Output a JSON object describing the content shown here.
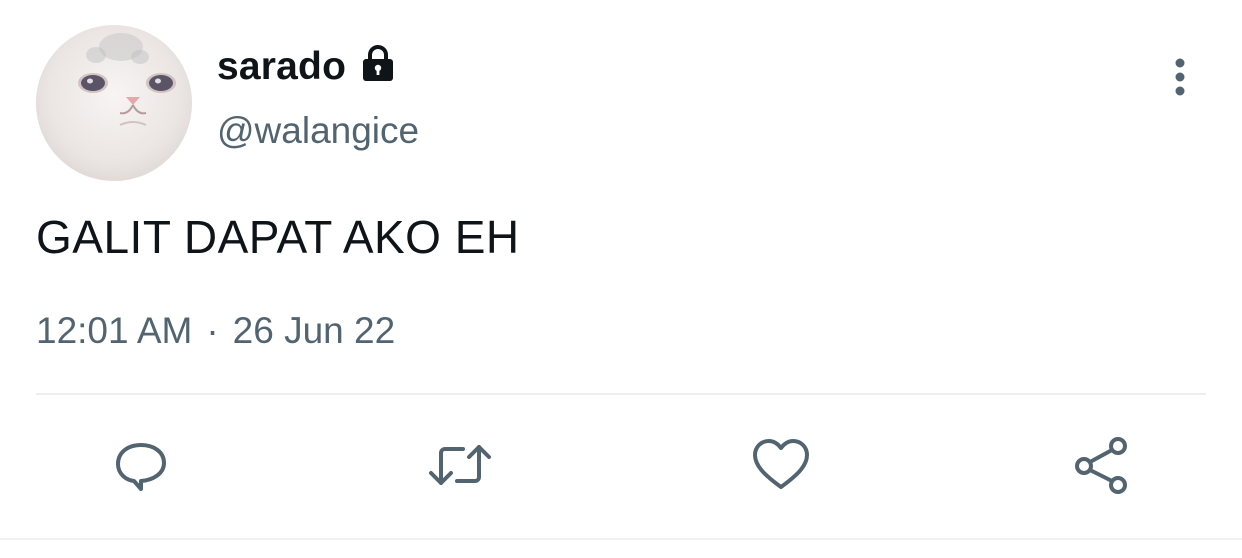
{
  "tweet": {
    "display_name": "sarado",
    "handle": "@walangice",
    "text": "GALIT DAPAT AKO EH",
    "time": "12:01 AM",
    "separator": "·",
    "date": "26 Jun 22",
    "icons": {
      "lock": "lock-icon",
      "more": "more-vertical-icon",
      "reply": "reply-icon",
      "retweet": "retweet-icon",
      "like": "heart-icon",
      "share": "share-icon"
    }
  },
  "colors": {
    "primary_text": "#0f1419",
    "secondary_text": "#536471",
    "divider": "#eceeef",
    "background": "#ffffff"
  }
}
